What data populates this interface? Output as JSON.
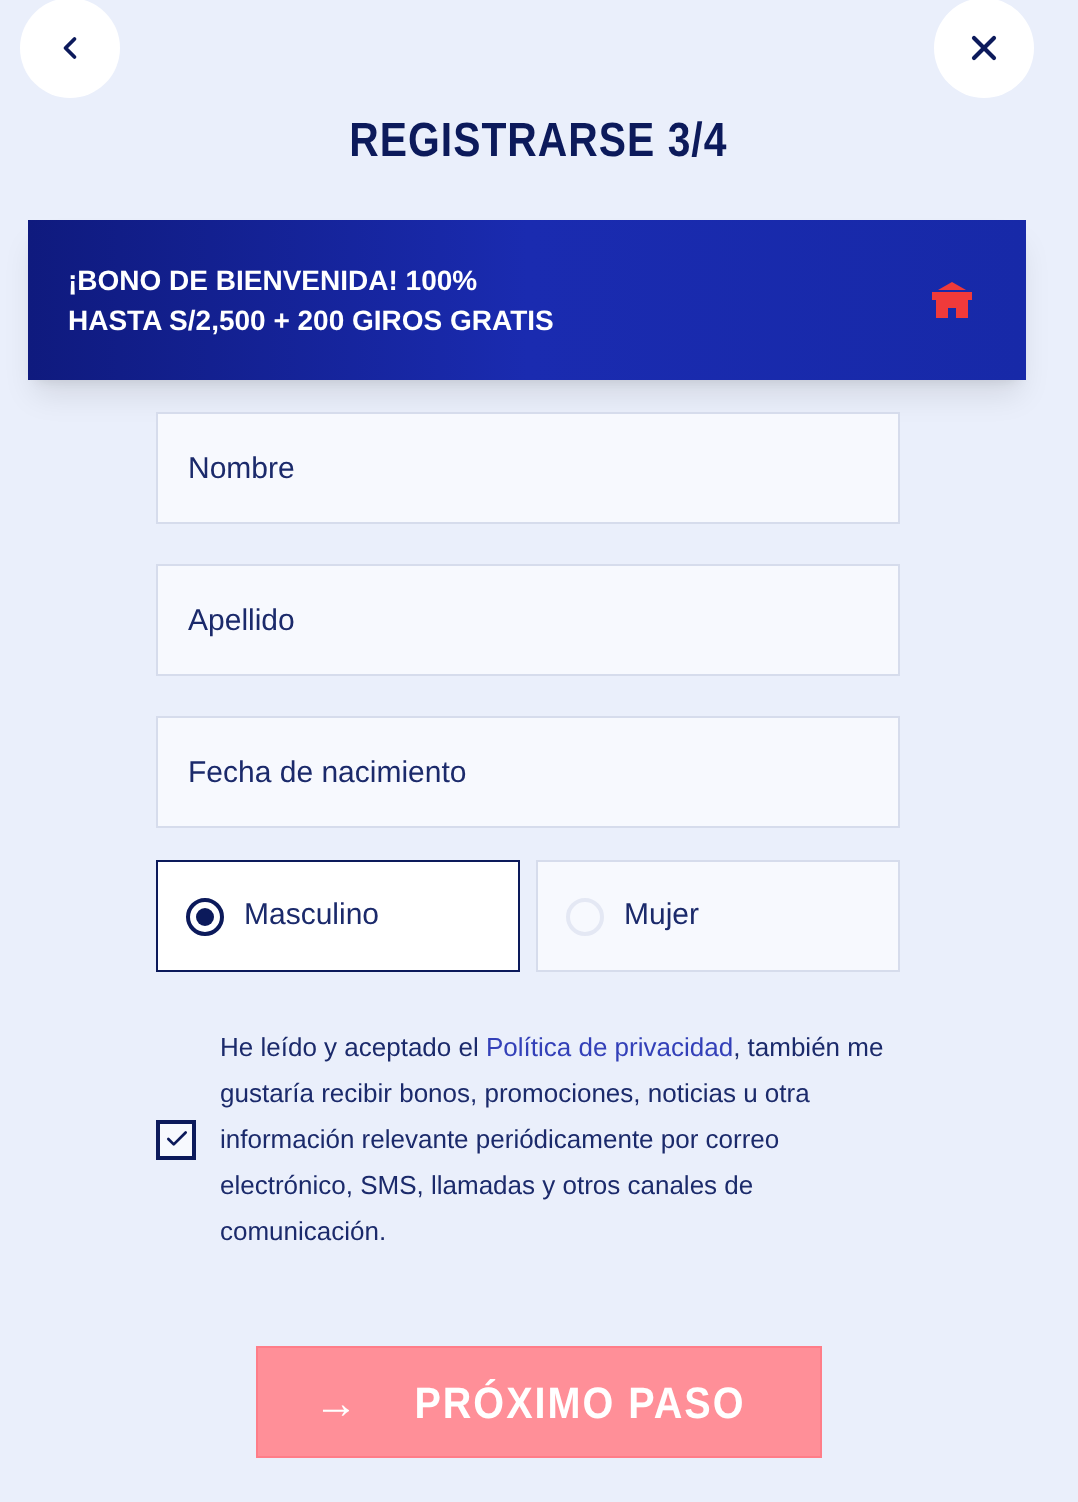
{
  "title": "REGISTRARSE 3/4",
  "banner": {
    "line1": "¡BONO DE BIENVENIDA! 100%",
    "line2": "HASTA S/2,500 + 200 GIROS GRATIS"
  },
  "fields": [
    {
      "placeholder": "Nombre"
    },
    {
      "placeholder": "Apellido"
    },
    {
      "placeholder": "Fecha de nacimiento"
    }
  ],
  "gender": [
    {
      "label": "Masculino",
      "selected": true
    },
    {
      "label": "Mujer",
      "selected": false
    }
  ],
  "consent": {
    "checked": true,
    "before": "He leído y aceptado el ",
    "link": "Política de privacidad",
    "after": ", también me gustaría recibir bonos, promociones, noticias u otra información relevante periódicamente por correo electrónico, SMS, llamadas y otros canales de comunicación."
  },
  "next_button": {
    "label": "PRÓXIMO PASO",
    "arrow": "→",
    "disabled": true
  }
}
